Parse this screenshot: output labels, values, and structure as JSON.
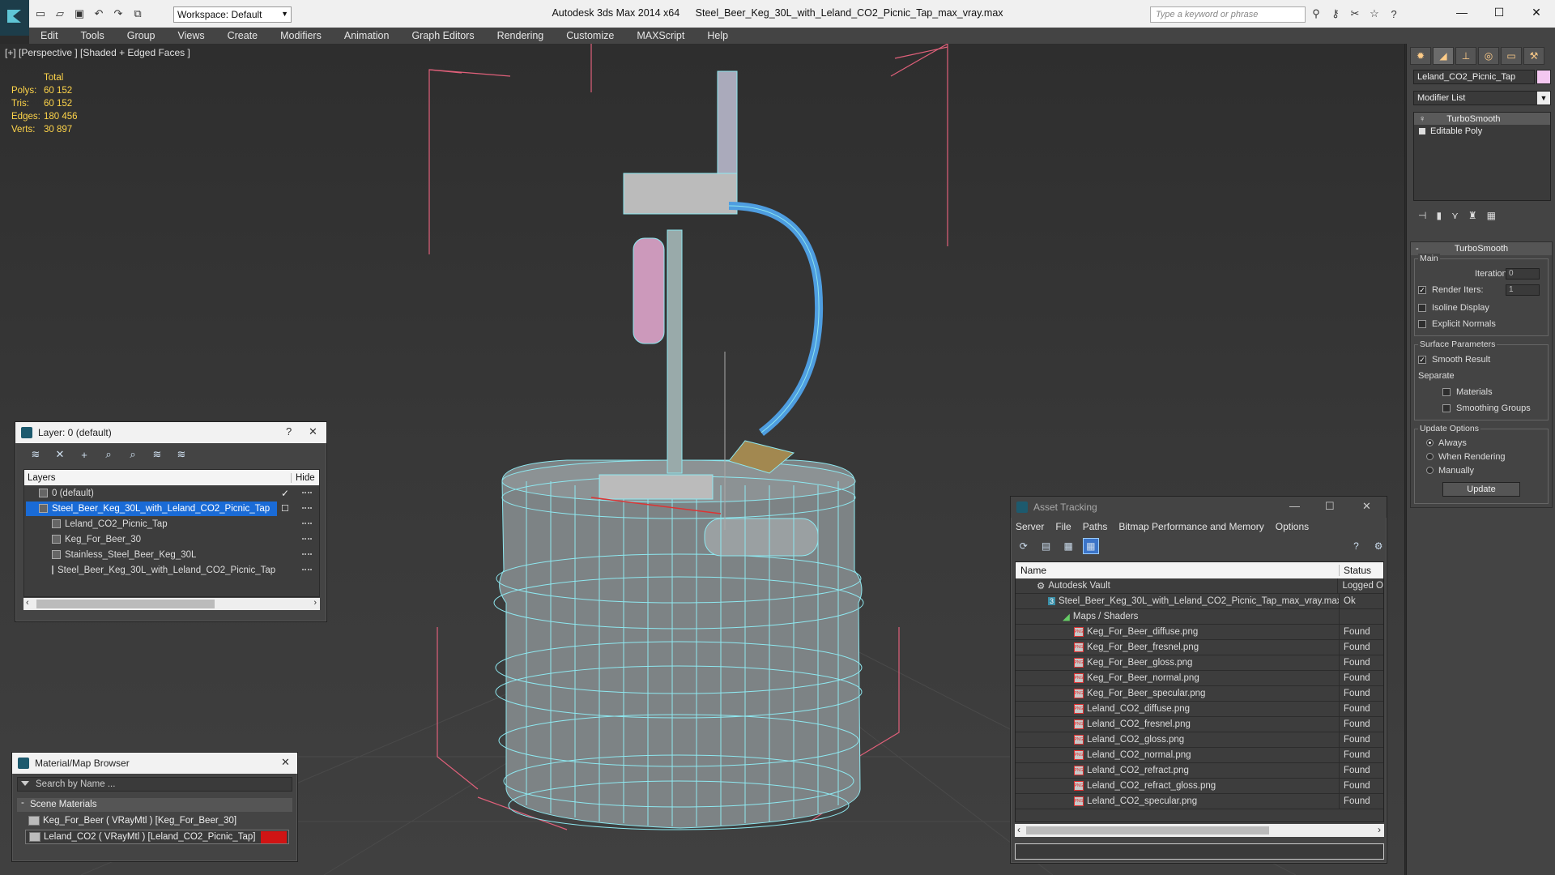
{
  "titlebar": {
    "workspace": "Workspace: Default",
    "app_name": "Autodesk 3ds Max  2014 x64",
    "file_name": "Steel_Beer_Keg_30L_with_Leland_CO2_Picnic_Tap_max_vray.max",
    "search_placeholder": "Type a keyword or phrase"
  },
  "menu": [
    "Edit",
    "Tools",
    "Group",
    "Views",
    "Create",
    "Modifiers",
    "Animation",
    "Graph Editors",
    "Rendering",
    "Customize",
    "MAXScript",
    "Help"
  ],
  "viewport": {
    "label": "[+] [Perspective ] [Shaded + Edged Faces ]",
    "stats_header": "Total",
    "stats": [
      {
        "label": "Polys:",
        "value": "60 152"
      },
      {
        "label": "Tris:",
        "value": "60 152"
      },
      {
        "label": "Edges:",
        "value": "180 456"
      },
      {
        "label": "Verts:",
        "value": "30 897"
      }
    ]
  },
  "layer_window": {
    "title": "Layer: 0 (default)",
    "help": "?",
    "col_layers": "Layers",
    "col_hide": "Hide",
    "rows": [
      {
        "name": "0 (default)"
      },
      {
        "name": "Steel_Beer_Keg_30L_with_Leland_CO2_Picnic_Tap"
      },
      {
        "name": "Leland_CO2_Picnic_Tap"
      },
      {
        "name": "Keg_For_Beer_30"
      },
      {
        "name": "Stainless_Steel_Beer_Keg_30L"
      },
      {
        "name": "Steel_Beer_Keg_30L_with_Leland_CO2_Picnic_Tap"
      }
    ]
  },
  "material_browser": {
    "title": "Material/Map Browser",
    "search_placeholder": "Search by Name ...",
    "group": "Scene Materials",
    "items": [
      {
        "name": "Keg_For_Beer  ( VRayMtl ) [Keg_For_Beer_30]"
      },
      {
        "name": "Leland_CO2  ( VRayMtl ) [Leland_CO2_Picnic_Tap]"
      }
    ]
  },
  "asset_tracking": {
    "title": "Asset Tracking",
    "menu": [
      "Server",
      "File",
      "Paths",
      "Bitmap Performance and Memory",
      "Options"
    ],
    "col_name": "Name",
    "col_status": "Status",
    "rows": [
      {
        "name": "Autodesk Vault",
        "status": "Logged O"
      },
      {
        "name": "Steel_Beer_Keg_30L_with_Leland_CO2_Picnic_Tap_max_vray.max",
        "status": "Ok"
      },
      {
        "name": "Maps / Shaders",
        "status": ""
      },
      {
        "name": "Keg_For_Beer_diffuse.png",
        "status": "Found"
      },
      {
        "name": "Keg_For_Beer_fresnel.png",
        "status": "Found"
      },
      {
        "name": "Keg_For_Beer_gloss.png",
        "status": "Found"
      },
      {
        "name": "Keg_For_Beer_normal.png",
        "status": "Found"
      },
      {
        "name": "Keg_For_Beer_specular.png",
        "status": "Found"
      },
      {
        "name": "Leland_CO2_diffuse.png",
        "status": "Found"
      },
      {
        "name": "Leland_CO2_fresnel.png",
        "status": "Found"
      },
      {
        "name": "Leland_CO2_gloss.png",
        "status": "Found"
      },
      {
        "name": "Leland_CO2_normal.png",
        "status": "Found"
      },
      {
        "name": "Leland_CO2_refract.png",
        "status": "Found"
      },
      {
        "name": "Leland_CO2_refract_gloss.png",
        "status": "Found"
      },
      {
        "name": "Leland_CO2_specular.png",
        "status": "Found"
      }
    ]
  },
  "command_panel": {
    "object_name": "Leland_CO2_Picnic_Tap",
    "object_color": "#f4c7f0",
    "modifier_list": "Modifier List",
    "stack": [
      "TurboSmooth",
      "Editable Poly"
    ],
    "rollout_title": "TurboSmooth",
    "main_group": "Main",
    "iterations_label": "Iterations:",
    "iterations_value": "0",
    "render_iters_label": "Render Iters:",
    "render_iters_value": "1",
    "isoline": "Isoline Display",
    "explicit_normals": "Explicit Normals",
    "surface_group": "Surface Parameters",
    "smooth_result": "Smooth Result",
    "separate": "Separate",
    "materials": "Materials",
    "smoothing_groups": "Smoothing Groups",
    "update_group": "Update Options",
    "always": "Always",
    "when_rendering": "When Rendering",
    "manually": "Manually",
    "update_button": "Update"
  },
  "colors": {
    "wire": "#8ee8f0",
    "selection": "#1a6bd6",
    "stats": "#ffd54a"
  }
}
